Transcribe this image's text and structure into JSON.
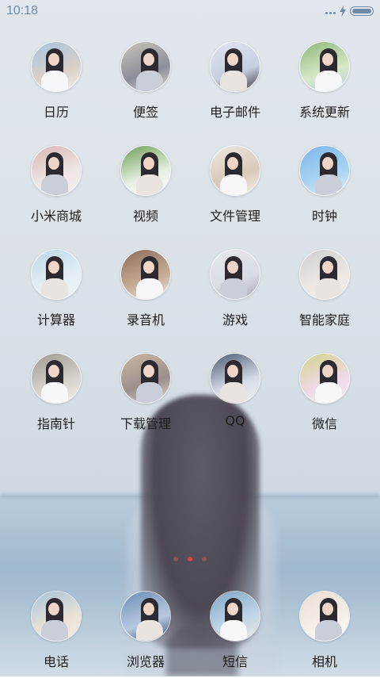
{
  "status_bar": {
    "time": "10:18"
  },
  "colors": {
    "status_text": "#6f8aa6",
    "active_page_dot": "#e0443c"
  },
  "apps": [
    {
      "label": "日历",
      "icon": "photo-icon-calendar"
    },
    {
      "label": "便签",
      "icon": "photo-icon-notes"
    },
    {
      "label": "电子邮件",
      "icon": "photo-icon-email"
    },
    {
      "label": "系统更新",
      "icon": "photo-icon-update"
    },
    {
      "label": "小米商城",
      "icon": "photo-icon-mi-store"
    },
    {
      "label": "视频",
      "icon": "photo-icon-video"
    },
    {
      "label": "文件管理",
      "icon": "photo-icon-file-manager"
    },
    {
      "label": "时钟",
      "icon": "photo-icon-clock"
    },
    {
      "label": "计算器",
      "icon": "photo-icon-calculator"
    },
    {
      "label": "录音机",
      "icon": "photo-icon-recorder"
    },
    {
      "label": "游戏",
      "icon": "photo-icon-games"
    },
    {
      "label": "智能家庭",
      "icon": "photo-icon-smart-home"
    },
    {
      "label": "指南针",
      "icon": "photo-icon-compass"
    },
    {
      "label": "下载管理",
      "icon": "photo-icon-downloads"
    },
    {
      "label": "QQ",
      "icon": "photo-icon-qq"
    },
    {
      "label": "微信",
      "icon": "photo-icon-wechat"
    }
  ],
  "dock": [
    {
      "label": "电话",
      "icon": "photo-icon-phone"
    },
    {
      "label": "浏览器",
      "icon": "photo-icon-browser"
    },
    {
      "label": "短信",
      "icon": "photo-icon-messages"
    },
    {
      "label": "相机",
      "icon": "photo-icon-camera"
    }
  ],
  "page_indicator": {
    "pages": 3,
    "active": 2
  }
}
